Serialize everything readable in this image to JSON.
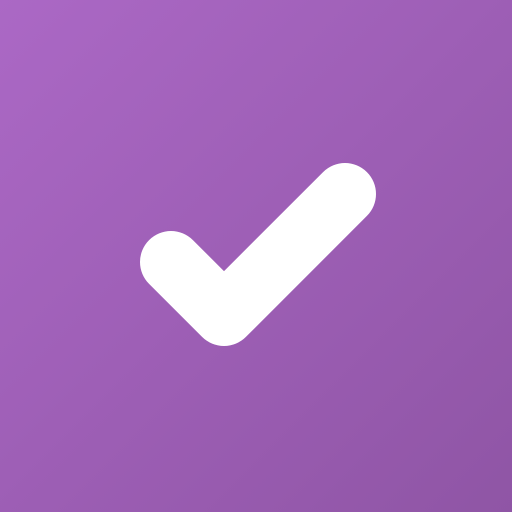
{
  "background": {
    "gradient_start": "#ab68c5",
    "gradient_end": "#8f55a5"
  },
  "icon": {
    "name": "check-icon",
    "color": "#ffffff"
  }
}
